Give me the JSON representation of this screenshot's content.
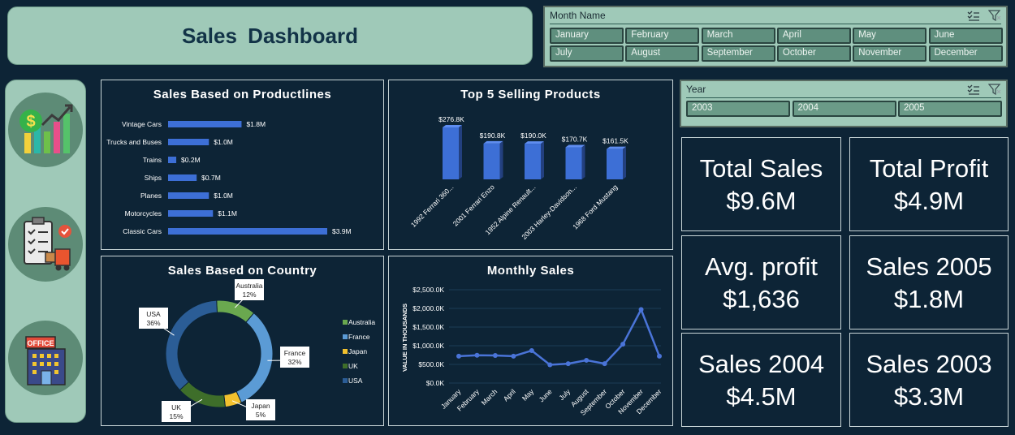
{
  "title": "Sales  Dashboard",
  "month_slicer": {
    "label": "Month Name",
    "items": [
      "January",
      "February",
      "March",
      "April",
      "May",
      "June",
      "July",
      "August",
      "September",
      "October",
      "November",
      "December"
    ]
  },
  "year_slicer": {
    "label": "Year",
    "items": [
      "2003",
      "2004",
      "2005"
    ]
  },
  "icons": [
    "sales-growth-icon",
    "logistics-checklist-icon",
    "office-building-icon"
  ],
  "panels": {
    "productlines_title": "Sales Based on Productlines",
    "top5_title": "Top 5 Selling Products",
    "country_title": "Sales Based on Country",
    "monthly_title": "Monthly Sales"
  },
  "kpis": [
    {
      "label": "Total Sales",
      "value": "$9.6M"
    },
    {
      "label": "Total Profit",
      "value": "$4.9M"
    },
    {
      "label": "Avg. profit",
      "value": "$1,636"
    },
    {
      "label": "Sales 2005",
      "value": "$1.8M"
    },
    {
      "label": "Sales 2004",
      "value": "$4.5M"
    },
    {
      "label": "Sales 2003",
      "value": "$3.3M"
    }
  ],
  "colors": {
    "background": "#0d2436",
    "accent_panel": "#9fc9b8",
    "bar_blue": "#3d6fd6",
    "australia": "#6aa84f",
    "france": "#5b9bd5",
    "japan": "#f2c12e",
    "uk": "#3e6e2a",
    "usa": "#2b5d96"
  },
  "chart_data": [
    {
      "type": "bar",
      "orientation": "horizontal",
      "title": "Sales Based on Productlines",
      "categories": [
        "Vintage Cars",
        "Trucks and Buses",
        "Trains",
        "Ships",
        "Planes",
        "Motorcycles",
        "Classic Cars"
      ],
      "values": [
        1.8,
        1.0,
        0.2,
        0.7,
        1.0,
        1.1,
        3.9
      ],
      "labels": [
        "$1.8M",
        "$1.0M",
        "$0.2M",
        "$0.7M",
        "$1.0M",
        "$1.1M",
        "$3.9M"
      ],
      "unit": "M"
    },
    {
      "type": "bar",
      "title": "Top 5 Selling Products",
      "categories": [
        "1992 Ferrari 360...",
        "2001 Ferrari Enzo",
        "1952 Alpine Renault...",
        "2003 Harley-Davidson...",
        "1968 Ford Mustang"
      ],
      "values": [
        276.8,
        190.8,
        190.0,
        170.7,
        161.5
      ],
      "labels": [
        "$276.8K",
        "$190.8K",
        "$190.0K",
        "$170.7K",
        "$161.5K"
      ],
      "unit": "K"
    },
    {
      "type": "pie",
      "variant": "doughnut",
      "title": "Sales Based on Country",
      "categories": [
        "Australia",
        "France",
        "Japan",
        "UK",
        "USA"
      ],
      "values": [
        12,
        32,
        5,
        15,
        36
      ],
      "labels": [
        "12%",
        "32%",
        "5%",
        "15%",
        "36%"
      ],
      "legend": "right"
    },
    {
      "type": "line",
      "title": "Monthly Sales",
      "ylabel": "VALUE IN THOUSANDS",
      "categories": [
        "January",
        "February",
        "March",
        "April",
        "May",
        "June",
        "July",
        "August",
        "September",
        "October",
        "November",
        "December"
      ],
      "values": [
        720,
        745,
        740,
        720,
        870,
        490,
        520,
        610,
        520,
        1040,
        1970,
        720
      ],
      "ylim": [
        0,
        2500
      ],
      "yticks": [
        "$0.0K",
        "$500.0K",
        "$1,000.0K",
        "$1,500.0K",
        "$2,000.0K",
        "$2,500.0K"
      ],
      "grid": true
    }
  ]
}
